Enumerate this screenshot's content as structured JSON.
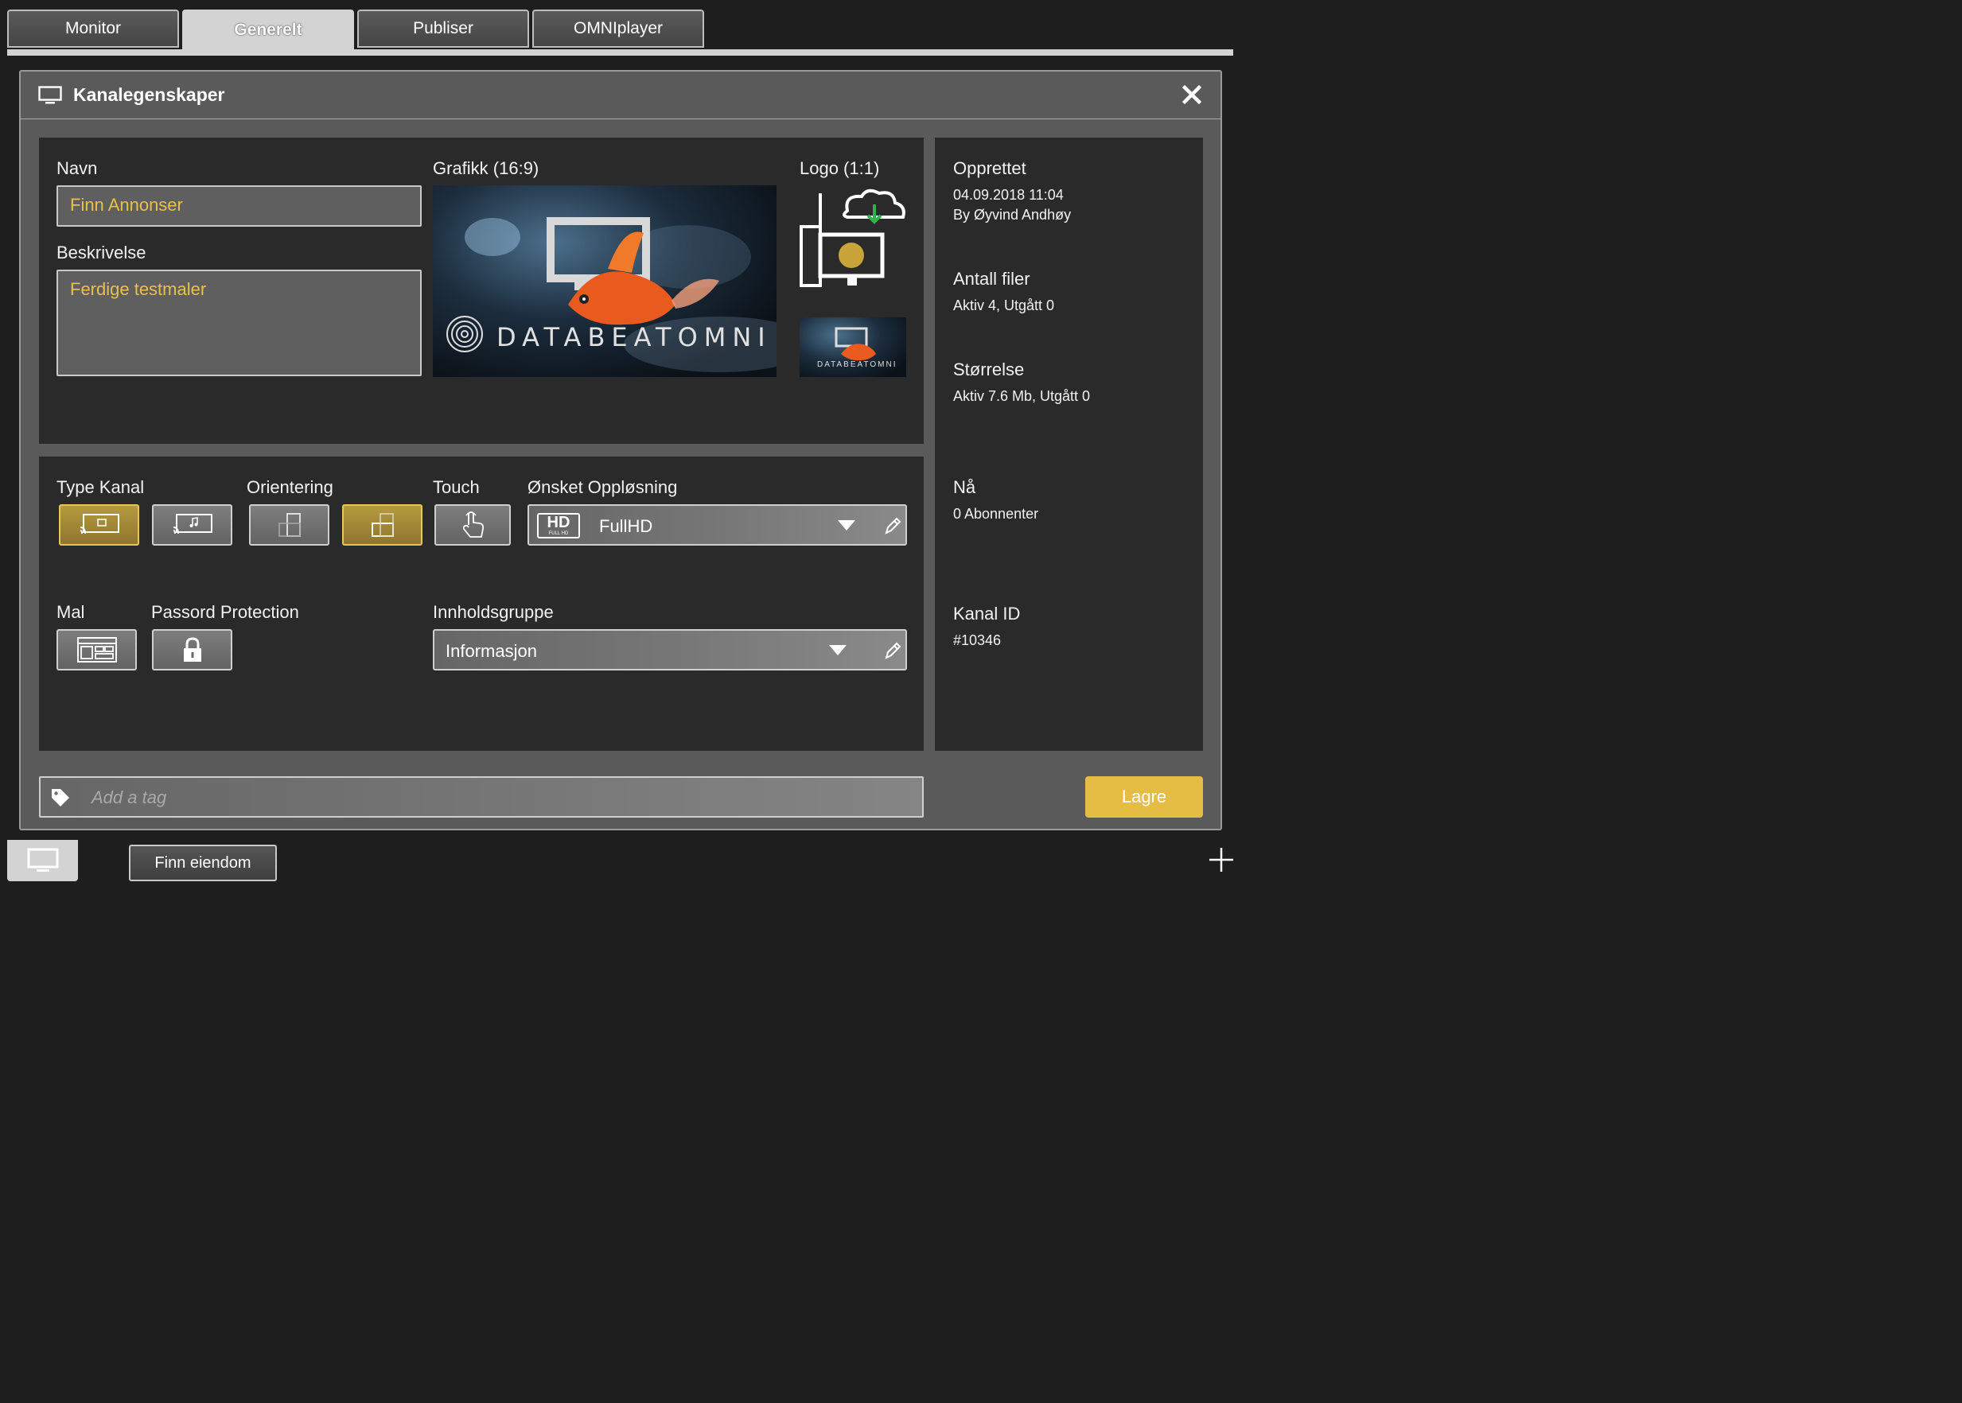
{
  "tabs": [
    {
      "label": "Monitor"
    },
    {
      "label": "Generelt",
      "active": true
    },
    {
      "label": "Publiser"
    },
    {
      "label": "OMNIplayer"
    }
  ],
  "window": {
    "title": "Kanalegenskaper",
    "icon": "monitor-icon",
    "close_icon": "close-icon"
  },
  "general": {
    "name_label": "Navn",
    "name_value": "Finn Annonser",
    "description_label": "Beskrivelse",
    "description_value": "Ferdige testmaler",
    "graphic_label": "Grafikk (16:9)",
    "logo_label": "Logo (1:1)",
    "brand_text": "DATABEATOMNI"
  },
  "settings": {
    "type_label": "Type Kanal",
    "type_options": [
      {
        "icon": "cast-video-icon",
        "selected": true
      },
      {
        "icon": "cast-audio-icon",
        "selected": false
      }
    ],
    "orientation_label": "Orientering",
    "orientation_options": [
      {
        "icon": "portrait-icon",
        "selected": false
      },
      {
        "icon": "landscape-icon",
        "selected": true
      }
    ],
    "touch_label": "Touch",
    "touch_icon": "touch-hand-icon",
    "resolution_label": "Ønsket Oppløsning",
    "resolution_badge": "HD",
    "resolution_badge_sub": "FULL HD",
    "resolution_value": "FullHD",
    "template_label": "Mal",
    "template_icon": "template-layout-icon",
    "password_label": "Passord Protection",
    "password_icon": "lock-icon",
    "content_group_label": "Innholdsgruppe",
    "content_group_value": "Informasjon"
  },
  "info": {
    "created_label": "Opprettet",
    "created_date": "04.09.2018 11:04",
    "created_by": "By Øyvind Andhøy",
    "files_label": "Antall filer",
    "files_value": "Aktiv 4, Utgått 0",
    "size_label": "Størrelse",
    "size_value": "Aktiv 7.6 Mb, Utgått 0",
    "now_label": "Nå",
    "now_value": "0 Abonnenter",
    "channel_id_label": "Kanal ID",
    "channel_id_value": "#10346"
  },
  "footer": {
    "tag_placeholder": "Add a tag",
    "save_label": "Lagre"
  },
  "bottom": {
    "channel_tab": "Finn eiendom"
  },
  "colors": {
    "accent": "#e5bd45",
    "value_text": "#e8c04d",
    "panel": "#2a2a2a",
    "window": "#5a5a5a"
  }
}
